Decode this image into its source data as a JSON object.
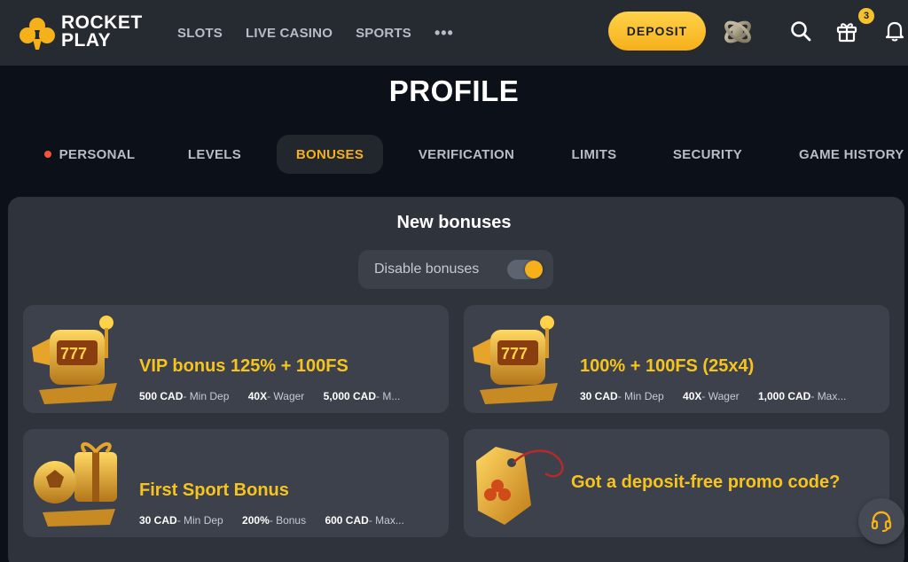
{
  "header": {
    "logo_line1": "ROCKET",
    "logo_line2": "PLAY",
    "nav": [
      "SLOTS",
      "LIVE CASINO",
      "SPORTS"
    ],
    "more": "•••",
    "deposit_label": "DEPOSIT",
    "gift_count": "3",
    "icons": [
      "search-icon",
      "gift-icon",
      "bell-icon"
    ]
  },
  "page": {
    "title": "PROFILE",
    "tabs": [
      "PERSONAL",
      "LEVELS",
      "BONUSES",
      "VERIFICATION",
      "LIMITS",
      "SECURITY",
      "GAME HISTORY"
    ],
    "active_tab": "BONUSES"
  },
  "bonuses": {
    "title": "New bonuses",
    "toggle_label": "Disable bonuses",
    "toggle_on": true,
    "cards": [
      {
        "title": "VIP bonus 125% + 100FS",
        "meta": [
          {
            "value": "500 CAD",
            "label": " - Min Dep"
          },
          {
            "value": "40X",
            "label": " - Wager"
          },
          {
            "value": "5,000 CAD",
            "label": " - M..."
          }
        ]
      },
      {
        "title": "100% + 100FS (25x4)",
        "meta": [
          {
            "value": "30 CAD",
            "label": " - Min Dep"
          },
          {
            "value": "40X",
            "label": " - Wager"
          },
          {
            "value": "1,000 CAD",
            "label": " - Max..."
          }
        ]
      },
      {
        "title": "First Sport Bonus",
        "meta": [
          {
            "value": "30 CAD",
            "label": " - Min Dep"
          },
          {
            "value": "200%",
            "label": " - Bonus"
          },
          {
            "value": "600 CAD",
            "label": " - Max..."
          }
        ]
      }
    ],
    "promo_title": "Got a deposit-free promo code?"
  },
  "colors": {
    "accent": "#f6b01a",
    "card_title": "#f7c41f",
    "bg": "#0c1119",
    "header": "#262a31",
    "panel": "#2f333b",
    "card": "#3c414b"
  }
}
